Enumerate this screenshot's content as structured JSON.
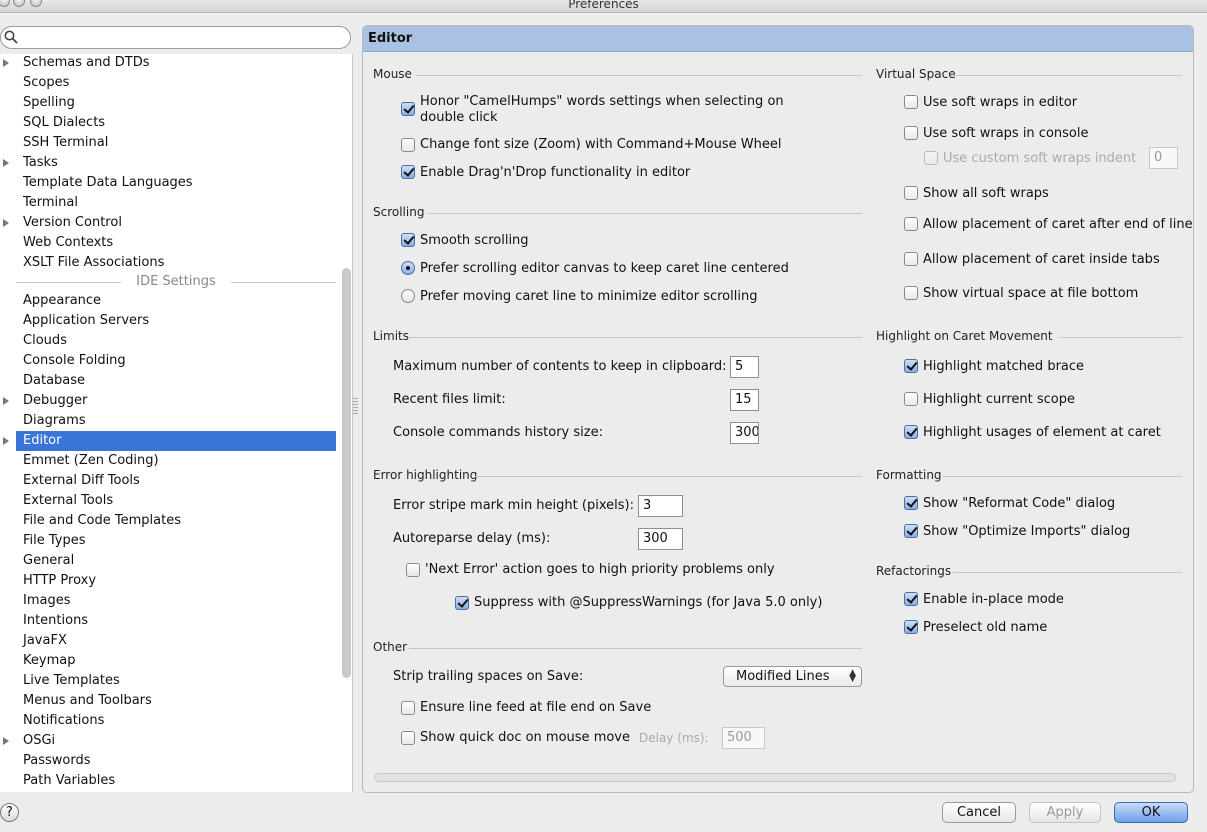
{
  "window": {
    "title": "Preferences"
  },
  "search": {
    "value": "",
    "placeholder": ""
  },
  "tree": {
    "items": [
      {
        "label": "Schemas and DTDs",
        "expandable": true
      },
      {
        "label": "Scopes"
      },
      {
        "label": "Spelling"
      },
      {
        "label": "SQL Dialects"
      },
      {
        "label": "SSH Terminal"
      },
      {
        "label": "Tasks",
        "expandable": true
      },
      {
        "label": "Template Data Languages"
      },
      {
        "label": "Terminal"
      },
      {
        "label": "Version Control",
        "expandable": true
      },
      {
        "label": "Web Contexts"
      },
      {
        "label": "XSLT File Associations"
      }
    ],
    "section": "IDE Settings",
    "ide_items": [
      {
        "label": "Appearance"
      },
      {
        "label": "Application Servers"
      },
      {
        "label": "Clouds"
      },
      {
        "label": "Console Folding"
      },
      {
        "label": "Database"
      },
      {
        "label": "Debugger",
        "expandable": true
      },
      {
        "label": "Diagrams"
      },
      {
        "label": "Editor",
        "expandable": true,
        "selected": true
      },
      {
        "label": "Emmet (Zen Coding)"
      },
      {
        "label": "External Diff Tools"
      },
      {
        "label": "External Tools"
      },
      {
        "label": "File and Code Templates"
      },
      {
        "label": "File Types"
      },
      {
        "label": "General"
      },
      {
        "label": "HTTP Proxy"
      },
      {
        "label": "Images"
      },
      {
        "label": "Intentions"
      },
      {
        "label": "JavaFX"
      },
      {
        "label": "Keymap"
      },
      {
        "label": "Live Templates"
      },
      {
        "label": "Menus and Toolbars"
      },
      {
        "label": "Notifications"
      },
      {
        "label": "OSGi",
        "expandable": true
      },
      {
        "label": "Passwords"
      },
      {
        "label": "Path Variables"
      }
    ]
  },
  "panel": {
    "title": "Editor",
    "mouse": {
      "heading": "Mouse",
      "camel_humps_1": "Honor \"CamelHumps\" words settings when selecting on",
      "camel_humps_2": "double click",
      "camel_humps_checked": true,
      "zoom": "Change font size (Zoom) with Command+Mouse Wheel",
      "zoom_checked": false,
      "dnd": "Enable Drag'n'Drop functionality in editor",
      "dnd_checked": true
    },
    "scrolling": {
      "heading": "Scrolling",
      "smooth": "Smooth scrolling",
      "smooth_checked": true,
      "centered": "Prefer scrolling editor canvas to keep caret line centered",
      "minimize": "Prefer moving caret line to minimize editor scrolling",
      "selected_option": "centered"
    },
    "limits": {
      "heading": "Limits",
      "clipboard_label": "Maximum number of contents to keep in clipboard:",
      "clipboard_value": "5",
      "recent_label": "Recent files limit:",
      "recent_value": "15",
      "console_label": "Console commands history size:",
      "console_value": "300"
    },
    "error_highlighting": {
      "heading": "Error highlighting",
      "stripe_label": "Error stripe mark min height (pixels):",
      "stripe_value": "3",
      "autoreparse_label": "Autoreparse delay (ms):",
      "autoreparse_value": "300",
      "next_error": "'Next Error' action goes to high priority problems only",
      "next_error_checked": false,
      "suppress": "Suppress with @SuppressWarnings (for Java 5.0 only)",
      "suppress_checked": true
    },
    "other": {
      "heading": "Other",
      "strip_label": "Strip trailing spaces on Save:",
      "strip_value": "Modified Lines",
      "line_feed": "Ensure line feed at file end on Save",
      "line_feed_checked": false,
      "quick_doc": "Show quick doc on mouse move",
      "quick_doc_checked": false,
      "delay_label": "Delay (ms):",
      "delay_value": "500"
    },
    "virtual_space": {
      "heading": "Virtual Space",
      "soft_wraps_editor": "Use soft wraps in editor",
      "soft_wraps_console": "Use soft wraps in console",
      "custom_indent": "Use custom soft wraps indent",
      "custom_indent_value": "0",
      "show_all": "Show all soft wraps",
      "after_end": "Allow placement of caret after end of line",
      "inside_tabs": "Allow placement of caret inside tabs",
      "file_bottom": "Show virtual space at file bottom"
    },
    "caret_movement": {
      "heading": "Highlight on Caret Movement",
      "matched_brace": "Highlight matched brace",
      "matched_brace_checked": true,
      "current_scope": "Highlight current scope",
      "current_scope_checked": false,
      "usages": "Highlight usages of element at caret",
      "usages_checked": true
    },
    "formatting": {
      "heading": "Formatting",
      "reformat": "Show \"Reformat Code\" dialog",
      "optimize": "Show \"Optimize Imports\" dialog"
    },
    "refactorings": {
      "heading": "Refactorings",
      "in_place": "Enable in-place mode",
      "preselect": "Preselect old name"
    }
  },
  "buttons": {
    "help": "?",
    "cancel": "Cancel",
    "apply": "Apply",
    "ok": "OK"
  },
  "colors": {
    "selection": "#3875d7",
    "header": "#a9c2e3"
  }
}
